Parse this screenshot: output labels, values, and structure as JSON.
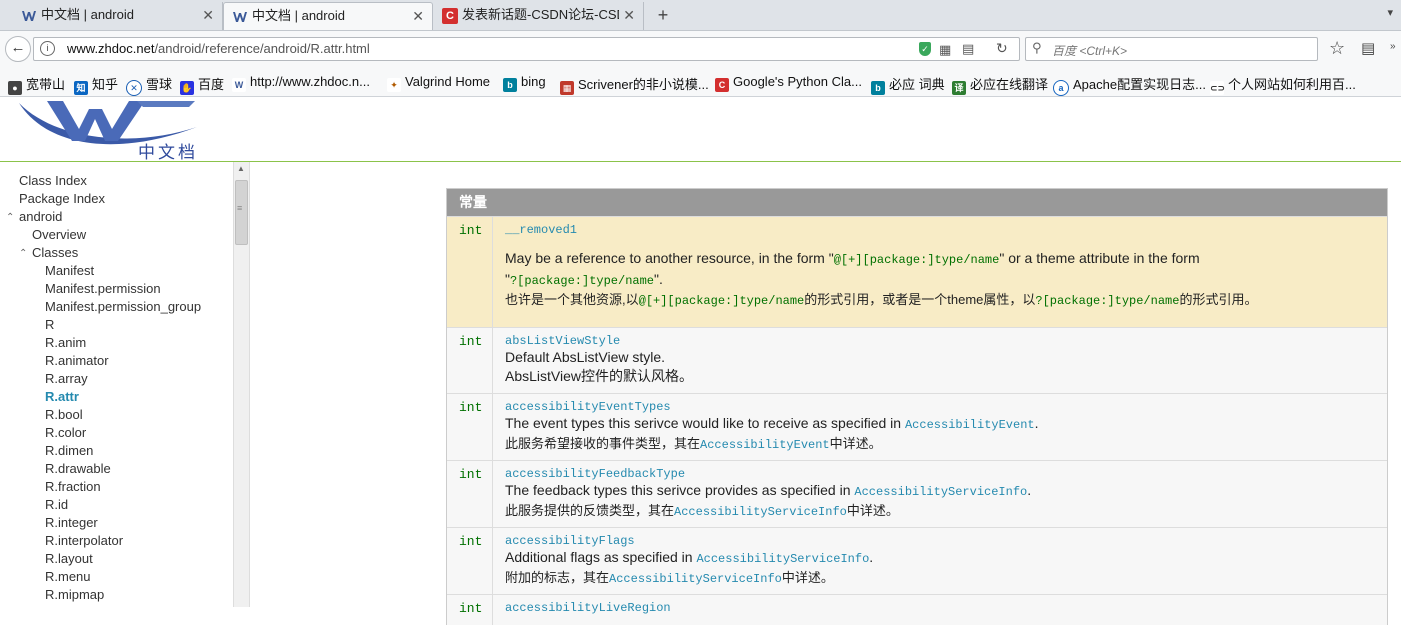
{
  "browser": {
    "tabs": [
      {
        "title": "中文档 | android",
        "active": false
      },
      {
        "title": "中文档 | android",
        "active": true
      },
      {
        "title": "发表新话题-CSDN论坛-CSDN",
        "active": false
      }
    ],
    "new_tab": "+",
    "url_host": "www.zhdoc.net",
    "url_path": "/android/reference/android/R.attr.html",
    "search_placeholder": "百度 <Ctrl+K>",
    "bookmarks": [
      {
        "label": "宽带山",
        "color": "#444444",
        "icon": "car-icon"
      },
      {
        "label": "知乎",
        "color": "#0a66c2",
        "icon": "zhihu-icon"
      },
      {
        "label": "雪球",
        "color": "#1a5fb4",
        "icon": "snowball-icon"
      },
      {
        "label": "百度",
        "color": "#2932e1",
        "icon": "baidu-icon"
      },
      {
        "label": "http://www.zhdoc.n...",
        "color": "#3b5998",
        "icon": "zhdoc-icon"
      },
      {
        "label": "Valgrind Home",
        "color": "#b05a00",
        "icon": "valgrind-icon"
      },
      {
        "label": "bing",
        "color": "#00809d",
        "icon": "bing-icon"
      },
      {
        "label": "Scrivener的非小说模...",
        "color": "#c0392b",
        "icon": "scrivener-icon"
      },
      {
        "label": "Google's Python Cla...",
        "color": "#d32f2f",
        "icon": "csdn-icon"
      },
      {
        "label": "必应 词典",
        "color": "#00809d",
        "icon": "bing-icon"
      },
      {
        "label": "必应在线翻译",
        "color": "#2e7d32",
        "icon": "translate-icon"
      },
      {
        "label": "Apache配置实现日志...",
        "color": "#1565c0",
        "icon": "apache-icon"
      },
      {
        "label": "个人网站如何利用百...",
        "color": "#333333",
        "icon": "link-icon"
      }
    ]
  },
  "site": {
    "logo_text": "中文档"
  },
  "sidebar": {
    "items": [
      {
        "label": "Class Index",
        "indent": 0
      },
      {
        "label": "Package Index",
        "indent": 0
      },
      {
        "label": "android",
        "indent": 0,
        "expanded": true
      },
      {
        "label": "Overview",
        "indent": 1
      },
      {
        "label": "Classes",
        "indent": 1,
        "expanded": true
      },
      {
        "label": "Manifest",
        "indent": 2
      },
      {
        "label": "Manifest.permission",
        "indent": 2
      },
      {
        "label": "Manifest.permission_group",
        "indent": 2
      },
      {
        "label": "R",
        "indent": 2
      },
      {
        "label": "R.anim",
        "indent": 2
      },
      {
        "label": "R.animator",
        "indent": 2
      },
      {
        "label": "R.array",
        "indent": 2
      },
      {
        "label": "R.attr",
        "indent": 2,
        "selected": true
      },
      {
        "label": "R.bool",
        "indent": 2
      },
      {
        "label": "R.color",
        "indent": 2
      },
      {
        "label": "R.dimen",
        "indent": 2
      },
      {
        "label": "R.drawable",
        "indent": 2
      },
      {
        "label": "R.fraction",
        "indent": 2
      },
      {
        "label": "R.id",
        "indent": 2
      },
      {
        "label": "R.integer",
        "indent": 2
      },
      {
        "label": "R.interpolator",
        "indent": 2
      },
      {
        "label": "R.layout",
        "indent": 2
      },
      {
        "label": "R.menu",
        "indent": 2
      },
      {
        "label": "R.mipmap",
        "indent": 2
      }
    ]
  },
  "constants": {
    "header": "常量",
    "rows": [
      {
        "type": "int",
        "name": "__removed1",
        "highlight": true,
        "desc_en_1": "May be a reference to another resource, in the form \"",
        "ref_form": "@[+][package:]type/name",
        "desc_en_2": "\" or a theme attribute in the form",
        "desc_en_3": "\"",
        "theme_form": "?[package:]type/name",
        "desc_en_4": "\".",
        "desc_cn_1": "也许是一个其他资源,以",
        "desc_cn_2": "的形式引用，或者是一个theme属性，以",
        "desc_cn_3": "的形式引用。"
      },
      {
        "type": "int",
        "name": "absListViewStyle",
        "desc_en": "Default AbsListView style.",
        "desc_cn": "AbsListView控件的默认风格。"
      },
      {
        "type": "int",
        "name": "accessibilityEventTypes",
        "desc_en": "The event types this serivce would like to receive as specified in ",
        "link": "AccessibilityEvent",
        "desc_en_end": ".",
        "desc_cn": "此服务希望接收的事件类型，其在",
        "desc_cn_end": "中详述。"
      },
      {
        "type": "int",
        "name": "accessibilityFeedbackType",
        "desc_en": "The feedback types this serivce provides as specified in ",
        "link": "AccessibilityServiceInfo",
        "desc_en_end": ".",
        "desc_cn": "此服务提供的反馈类型，其在",
        "desc_cn_end": "中详述。"
      },
      {
        "type": "int",
        "name": "accessibilityFlags",
        "desc_en": "Additional flags as specified in ",
        "link": "AccessibilityServiceInfo",
        "desc_en_end": ".",
        "desc_cn": "附加的标志，其在",
        "desc_cn_end": "中详述。"
      },
      {
        "type": "int",
        "name": "accessibilityLiveRegion"
      }
    ]
  }
}
